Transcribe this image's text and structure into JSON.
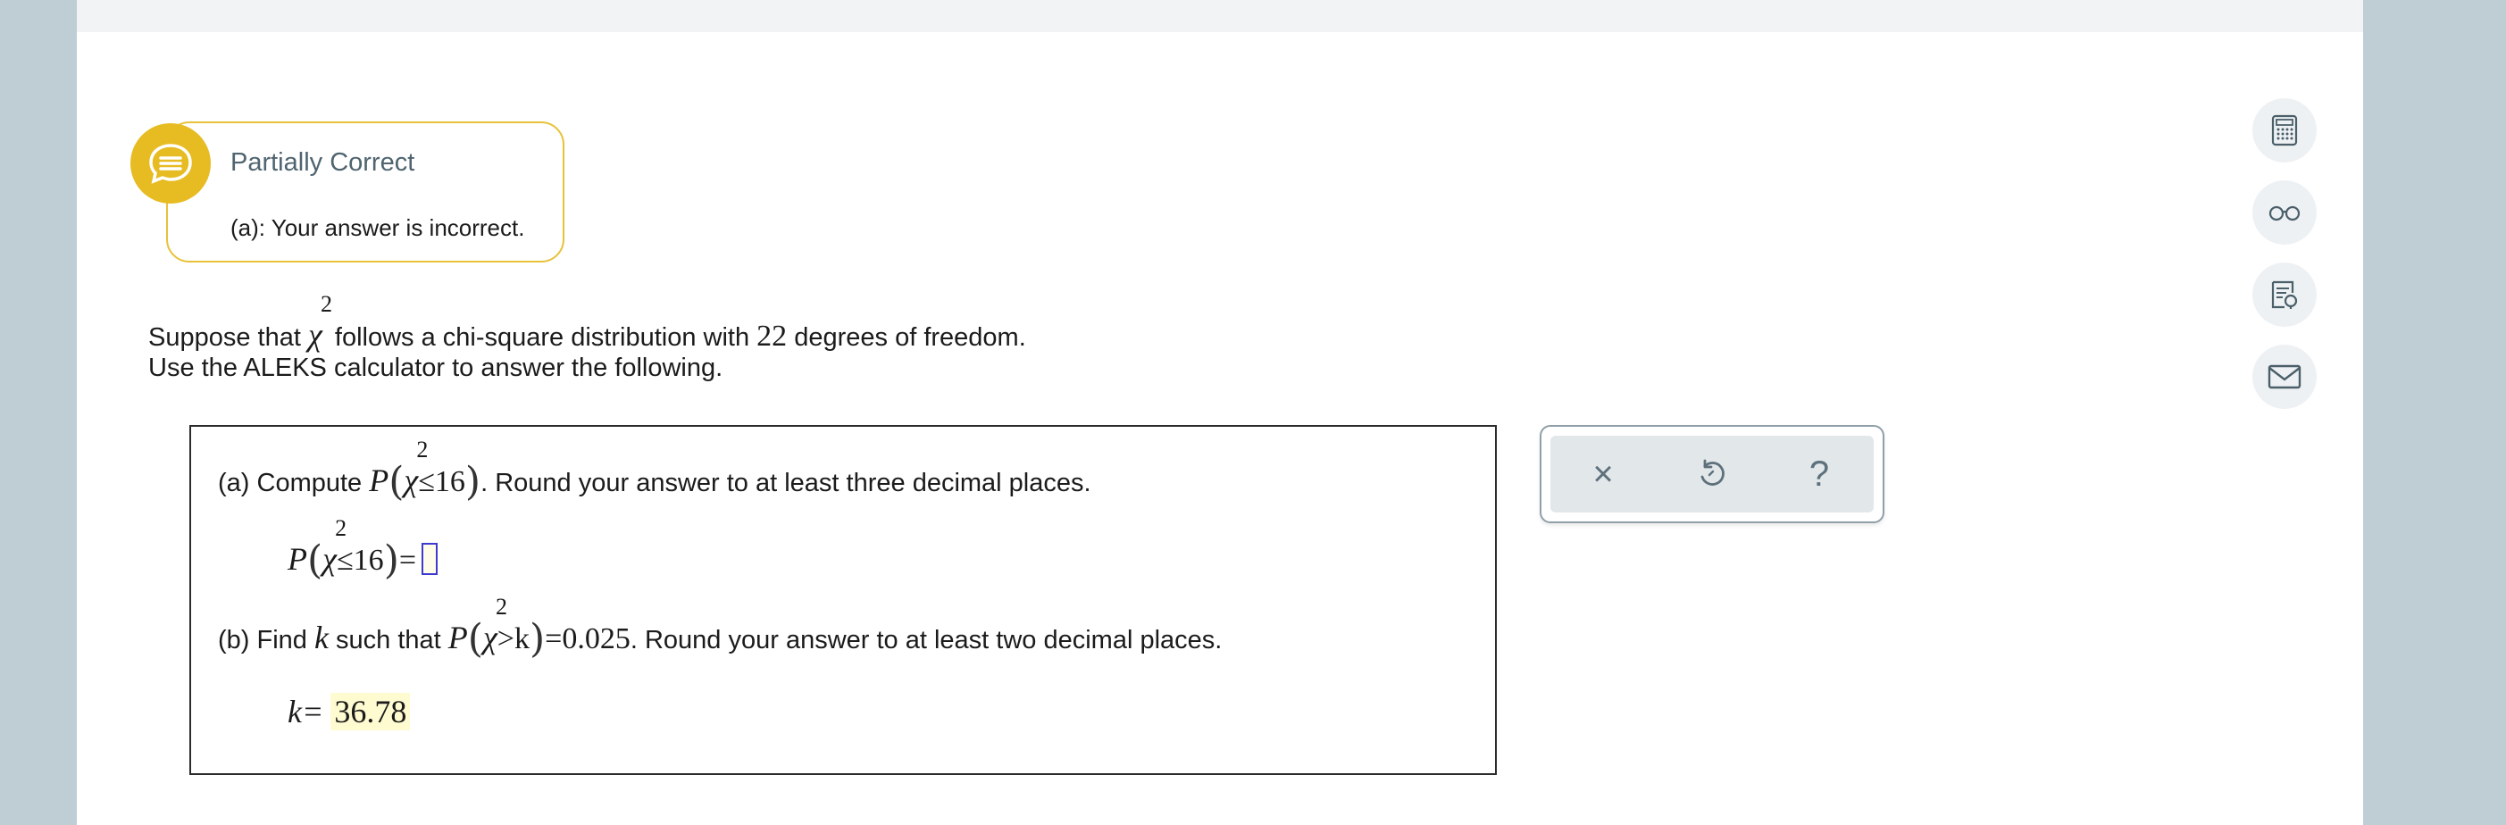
{
  "feedback": {
    "title": "Partially Correct",
    "message": "(a): Your answer is incorrect.",
    "accent_color": "#e7bb22",
    "icon": "chat-bubble-icon"
  },
  "problem": {
    "intro_line1_before": "Suppose that",
    "chi_symbol": "χ",
    "chi_exponent": "2",
    "intro_line1_mid": "follows a chi-square distribution with",
    "degrees": "22",
    "intro_line1_after": "degrees of freedom.",
    "intro_line2": "Use the ALEKS calculator to answer the following."
  },
  "part_a": {
    "label": "(a) Compute",
    "P": "P",
    "inequality": "≤16",
    "instruction": ". Round your answer to at least three decimal places.",
    "answer_lhs_ineq": "≤16",
    "equals": "=",
    "answer_value": ""
  },
  "part_b": {
    "label": "(b) Find",
    "k": "k",
    "such_that": "such that",
    "P": "P",
    "inequality": ">k",
    "equals_value": "=0.025",
    "instruction": ". Round your answer to at least two decimal places.",
    "answer_label": "k=",
    "answer_value": "36.78"
  },
  "tools": {
    "clear_icon": "close-icon",
    "undo_icon": "undo-icon",
    "help_icon": "help-icon",
    "clear_glyph": "×",
    "help_glyph": "?"
  },
  "side_icons": [
    "calculator-icon",
    "glasses-icon",
    "textbook-icon",
    "mail-icon"
  ]
}
